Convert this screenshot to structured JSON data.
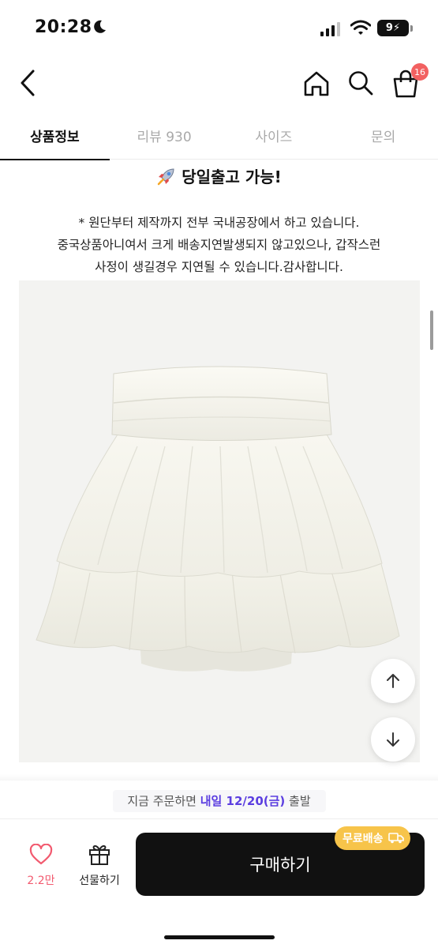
{
  "status_bar": {
    "time": "20:28",
    "battery": "9"
  },
  "nav": {
    "cart_count": "16"
  },
  "tabs": [
    {
      "label": "상품정보",
      "active": true
    },
    {
      "label": "리뷰 930",
      "active": false
    },
    {
      "label": "사이즈",
      "active": false
    },
    {
      "label": "문의",
      "active": false
    }
  ],
  "content": {
    "ship_banner": "당일출고 가능!",
    "notice_lines": [
      "* 원단부터 제작까지 전부 국내공장에서 하고 있습니다.",
      "중국상품아니여서 크게 배송지연발생되지 않고있으나, 갑작스런",
      "사정이 생길경우 지연될 수 있습니다.감사합니다."
    ]
  },
  "delivery": {
    "prefix": "지금 주문하면 ",
    "date": "내일 12/20(금)",
    "suffix": " 출발"
  },
  "actions": {
    "like_count": "2.2만",
    "gift_label": "선물하기",
    "buy_label": "구매하기",
    "free_ship_label": "무료배송"
  },
  "colors": {
    "accent_purple": "#5b3ee0",
    "like_pink": "#f25a6f",
    "badge_red": "#f26161",
    "free_ship_yellow": "#f7c44a",
    "buy_button": "#111111"
  },
  "icons": [
    "back-icon",
    "home-icon",
    "search-icon",
    "cart-icon",
    "rocket-icon",
    "arrow-up-icon",
    "arrow-down-icon",
    "heart-icon",
    "gift-icon",
    "truck-icon",
    "moon-icon",
    "signal-icon",
    "wifi-icon",
    "battery-icon"
  ]
}
